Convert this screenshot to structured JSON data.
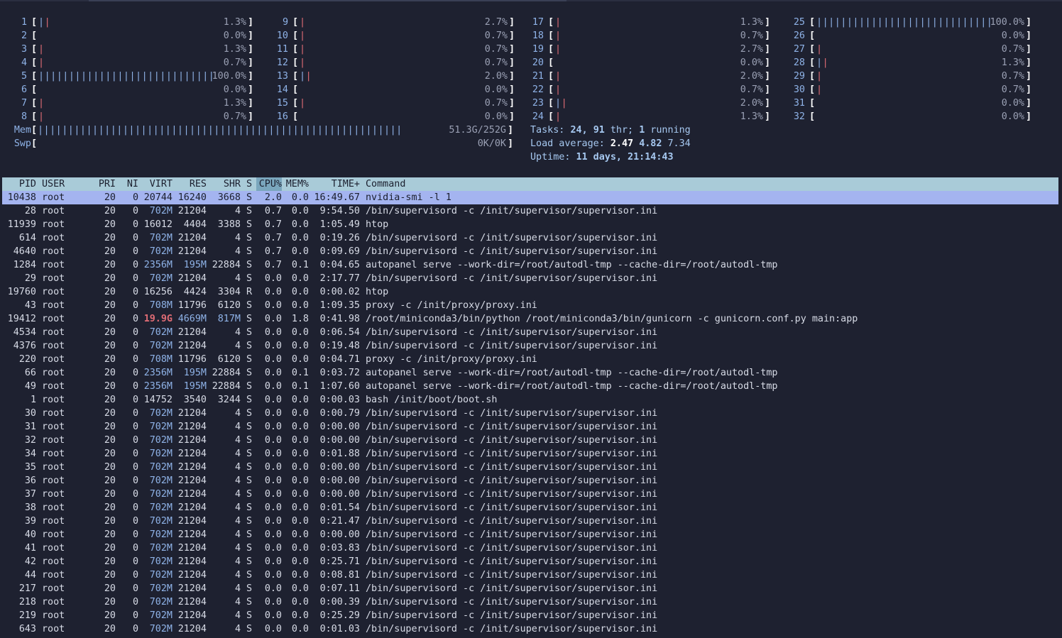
{
  "cpus": [
    {
      "n": "1",
      "bars": "||",
      "pct": "1.3%",
      "level": 0.013
    },
    {
      "n": "2",
      "bars": "",
      "pct": "0.0%",
      "level": 0.0
    },
    {
      "n": "3",
      "bars": "|",
      "pct": "1.3%",
      "level": 0.013
    },
    {
      "n": "4",
      "bars": "|",
      "pct": "0.7%",
      "level": 0.007
    },
    {
      "n": "5",
      "bars": "||||||||||||||||||||||||||||||||||||||||||",
      "pct": "100.0%",
      "level": 1.0
    },
    {
      "n": "6",
      "bars": "",
      "pct": "0.0%",
      "level": 0.0
    },
    {
      "n": "7",
      "bars": "|",
      "pct": "1.3%",
      "level": 0.013
    },
    {
      "n": "8",
      "bars": "|",
      "pct": "0.7%",
      "level": 0.007
    },
    {
      "n": "9",
      "bars": "|",
      "pct": "2.7%",
      "level": 0.027
    },
    {
      "n": "10",
      "bars": "|",
      "pct": "0.7%",
      "level": 0.007
    },
    {
      "n": "11",
      "bars": "|",
      "pct": "0.7%",
      "level": 0.007
    },
    {
      "n": "12",
      "bars": "|",
      "pct": "0.7%",
      "level": 0.007
    },
    {
      "n": "13",
      "bars": "||",
      "pct": "2.0%",
      "level": 0.02
    },
    {
      "n": "14",
      "bars": "",
      "pct": "0.0%",
      "level": 0.0
    },
    {
      "n": "15",
      "bars": "|",
      "pct": "0.7%",
      "level": 0.007
    },
    {
      "n": "16",
      "bars": "",
      "pct": "0.0%",
      "level": 0.0
    },
    {
      "n": "17",
      "bars": "|",
      "pct": "1.3%",
      "level": 0.013
    },
    {
      "n": "18",
      "bars": "|",
      "pct": "0.7%",
      "level": 0.007
    },
    {
      "n": "19",
      "bars": "|",
      "pct": "2.7%",
      "level": 0.027
    },
    {
      "n": "20",
      "bars": "",
      "pct": "0.0%",
      "level": 0.0
    },
    {
      "n": "21",
      "bars": "|",
      "pct": "2.0%",
      "level": 0.02
    },
    {
      "n": "22",
      "bars": "|",
      "pct": "0.7%",
      "level": 0.007
    },
    {
      "n": "23",
      "bars": "||",
      "pct": "2.0%",
      "level": 0.02
    },
    {
      "n": "24",
      "bars": "|",
      "pct": "1.3%",
      "level": 0.013
    },
    {
      "n": "25",
      "bars": "||||||||||||||||||||||||||||||||||||||||||",
      "pct": "100.0%",
      "level": 1.0
    },
    {
      "n": "26",
      "bars": "",
      "pct": "0.0%",
      "level": 0.0
    },
    {
      "n": "27",
      "bars": "|",
      "pct": "0.7%",
      "level": 0.007
    },
    {
      "n": "28",
      "bars": "||",
      "pct": "1.3%",
      "level": 0.013
    },
    {
      "n": "29",
      "bars": "|",
      "pct": "0.7%",
      "level": 0.007
    },
    {
      "n": "30",
      "bars": "|",
      "pct": "0.7%",
      "level": 0.007
    },
    {
      "n": "31",
      "bars": "",
      "pct": "0.0%",
      "level": 0.0
    },
    {
      "n": "32",
      "bars": "",
      "pct": "0.0%",
      "level": 0.0
    }
  ],
  "mem": {
    "label": "Mem",
    "bars": "|||||||||||||||||||||||||||||||||||||||||||||||||||||||||||||||||||||||||||||||||||",
    "value": "51.3G/252G"
  },
  "swp": {
    "label": "Swp",
    "value": "0K/0K"
  },
  "tasks": {
    "prefix": "Tasks: ",
    "count": "24",
    "sep": ", ",
    "thr": "91",
    "thr_label": " thr; ",
    "running": "1",
    "running_label": " running"
  },
  "load": {
    "prefix": "Load average: ",
    "l1": "2.47",
    "l5": "4.82",
    "l15": "7.34"
  },
  "uptime": {
    "prefix": "Uptime: ",
    "value": "11 days, 21:14:43"
  },
  "columns": {
    "pid": "PID",
    "user": "USER",
    "pri": "PRI",
    "ni": "NI",
    "virt": "VIRT",
    "res": "RES",
    "shr": "SHR",
    "s": "S",
    "cpu": "CPU%",
    "mem": "MEM%",
    "time": "TIME+",
    "cmd": "Command"
  },
  "processes": [
    {
      "pid": "10438",
      "user": "root",
      "pri": "20",
      "ni": "0",
      "virt": "20744",
      "res": "16240",
      "shr": "3668",
      "s": "S",
      "cpu": "2.0",
      "mem": "0.0",
      "time": "16:49.67",
      "cmd": "nvidia-smi -l 1"
    },
    {
      "pid": "28",
      "user": "root",
      "pri": "20",
      "ni": "0",
      "virt": "702M",
      "res": "21204",
      "shr": "4",
      "s": "S",
      "cpu": "0.7",
      "mem": "0.0",
      "time": "9:54.50",
      "cmd": "/bin/supervisord -c /init/supervisor/supervisor.ini"
    },
    {
      "pid": "11939",
      "user": "root",
      "pri": "20",
      "ni": "0",
      "virt": "16012",
      "res": "4404",
      "shr": "3388",
      "s": "S",
      "cpu": "0.7",
      "mem": "0.0",
      "time": "1:05.49",
      "cmd": "htop"
    },
    {
      "pid": "614",
      "user": "root",
      "pri": "20",
      "ni": "0",
      "virt": "702M",
      "res": "21204",
      "shr": "4",
      "s": "S",
      "cpu": "0.7",
      "mem": "0.0",
      "time": "0:19.26",
      "cmd": "/bin/supervisord -c /init/supervisor/supervisor.ini"
    },
    {
      "pid": "4640",
      "user": "root",
      "pri": "20",
      "ni": "0",
      "virt": "702M",
      "res": "21204",
      "shr": "4",
      "s": "S",
      "cpu": "0.7",
      "mem": "0.0",
      "time": "0:09.69",
      "cmd": "/bin/supervisord -c /init/supervisor/supervisor.ini"
    },
    {
      "pid": "1284",
      "user": "root",
      "pri": "20",
      "ni": "0",
      "virt": "2356M",
      "res": "195M",
      "shr": "22884",
      "s": "S",
      "cpu": "0.7",
      "mem": "0.1",
      "time": "0:04.65",
      "cmd": "autopanel serve --work-dir=/root/autodl-tmp --cache-dir=/root/autodl-tmp"
    },
    {
      "pid": "29",
      "user": "root",
      "pri": "20",
      "ni": "0",
      "virt": "702M",
      "res": "21204",
      "shr": "4",
      "s": "S",
      "cpu": "0.0",
      "mem": "0.0",
      "time": "2:17.77",
      "cmd": "/bin/supervisord -c /init/supervisor/supervisor.ini"
    },
    {
      "pid": "19760",
      "user": "root",
      "pri": "20",
      "ni": "0",
      "virt": "16256",
      "res": "4424",
      "shr": "3304",
      "s": "R",
      "cpu": "0.0",
      "mem": "0.0",
      "time": "0:00.02",
      "cmd": "htop"
    },
    {
      "pid": "43",
      "user": "root",
      "pri": "20",
      "ni": "0",
      "virt": "708M",
      "res": "11796",
      "shr": "6120",
      "s": "S",
      "cpu": "0.0",
      "mem": "0.0",
      "time": "1:09.35",
      "cmd": "proxy -c /init/proxy/proxy.ini"
    },
    {
      "pid": "19412",
      "user": "root",
      "pri": "20",
      "ni": "0",
      "virt": "19.9G",
      "res": "4669M",
      "shr": "817M",
      "s": "S",
      "cpu": "0.0",
      "mem": "1.8",
      "time": "0:41.98",
      "cmd": "/root/miniconda3/bin/python /root/miniconda3/bin/gunicorn -c gunicorn.conf.py main:app"
    },
    {
      "pid": "4534",
      "user": "root",
      "pri": "20",
      "ni": "0",
      "virt": "702M",
      "res": "21204",
      "shr": "4",
      "s": "S",
      "cpu": "0.0",
      "mem": "0.0",
      "time": "0:06.54",
      "cmd": "/bin/supervisord -c /init/supervisor/supervisor.ini"
    },
    {
      "pid": "4376",
      "user": "root",
      "pri": "20",
      "ni": "0",
      "virt": "702M",
      "res": "21204",
      "shr": "4",
      "s": "S",
      "cpu": "0.0",
      "mem": "0.0",
      "time": "0:19.48",
      "cmd": "/bin/supervisord -c /init/supervisor/supervisor.ini"
    },
    {
      "pid": "220",
      "user": "root",
      "pri": "20",
      "ni": "0",
      "virt": "708M",
      "res": "11796",
      "shr": "6120",
      "s": "S",
      "cpu": "0.0",
      "mem": "0.0",
      "time": "0:04.71",
      "cmd": "proxy -c /init/proxy/proxy.ini"
    },
    {
      "pid": "66",
      "user": "root",
      "pri": "20",
      "ni": "0",
      "virt": "2356M",
      "res": "195M",
      "shr": "22884",
      "s": "S",
      "cpu": "0.0",
      "mem": "0.1",
      "time": "0:03.72",
      "cmd": "autopanel serve --work-dir=/root/autodl-tmp --cache-dir=/root/autodl-tmp"
    },
    {
      "pid": "49",
      "user": "root",
      "pri": "20",
      "ni": "0",
      "virt": "2356M",
      "res": "195M",
      "shr": "22884",
      "s": "S",
      "cpu": "0.0",
      "mem": "0.1",
      "time": "1:07.60",
      "cmd": "autopanel serve --work-dir=/root/autodl-tmp --cache-dir=/root/autodl-tmp"
    },
    {
      "pid": "1",
      "user": "root",
      "pri": "20",
      "ni": "0",
      "virt": "14752",
      "res": "3540",
      "shr": "3244",
      "s": "S",
      "cpu": "0.0",
      "mem": "0.0",
      "time": "0:00.03",
      "cmd": "bash /init/boot/boot.sh"
    },
    {
      "pid": "30",
      "user": "root",
      "pri": "20",
      "ni": "0",
      "virt": "702M",
      "res": "21204",
      "shr": "4",
      "s": "S",
      "cpu": "0.0",
      "mem": "0.0",
      "time": "0:00.79",
      "cmd": "/bin/supervisord -c /init/supervisor/supervisor.ini"
    },
    {
      "pid": "31",
      "user": "root",
      "pri": "20",
      "ni": "0",
      "virt": "702M",
      "res": "21204",
      "shr": "4",
      "s": "S",
      "cpu": "0.0",
      "mem": "0.0",
      "time": "0:00.00",
      "cmd": "/bin/supervisord -c /init/supervisor/supervisor.ini"
    },
    {
      "pid": "32",
      "user": "root",
      "pri": "20",
      "ni": "0",
      "virt": "702M",
      "res": "21204",
      "shr": "4",
      "s": "S",
      "cpu": "0.0",
      "mem": "0.0",
      "time": "0:00.00",
      "cmd": "/bin/supervisord -c /init/supervisor/supervisor.ini"
    },
    {
      "pid": "34",
      "user": "root",
      "pri": "20",
      "ni": "0",
      "virt": "702M",
      "res": "21204",
      "shr": "4",
      "s": "S",
      "cpu": "0.0",
      "mem": "0.0",
      "time": "0:01.88",
      "cmd": "/bin/supervisord -c /init/supervisor/supervisor.ini"
    },
    {
      "pid": "35",
      "user": "root",
      "pri": "20",
      "ni": "0",
      "virt": "702M",
      "res": "21204",
      "shr": "4",
      "s": "S",
      "cpu": "0.0",
      "mem": "0.0",
      "time": "0:00.00",
      "cmd": "/bin/supervisord -c /init/supervisor/supervisor.ini"
    },
    {
      "pid": "36",
      "user": "root",
      "pri": "20",
      "ni": "0",
      "virt": "702M",
      "res": "21204",
      "shr": "4",
      "s": "S",
      "cpu": "0.0",
      "mem": "0.0",
      "time": "0:00.00",
      "cmd": "/bin/supervisord -c /init/supervisor/supervisor.ini"
    },
    {
      "pid": "37",
      "user": "root",
      "pri": "20",
      "ni": "0",
      "virt": "702M",
      "res": "21204",
      "shr": "4",
      "s": "S",
      "cpu": "0.0",
      "mem": "0.0",
      "time": "0:00.00",
      "cmd": "/bin/supervisord -c /init/supervisor/supervisor.ini"
    },
    {
      "pid": "38",
      "user": "root",
      "pri": "20",
      "ni": "0",
      "virt": "702M",
      "res": "21204",
      "shr": "4",
      "s": "S",
      "cpu": "0.0",
      "mem": "0.0",
      "time": "0:01.54",
      "cmd": "/bin/supervisord -c /init/supervisor/supervisor.ini"
    },
    {
      "pid": "39",
      "user": "root",
      "pri": "20",
      "ni": "0",
      "virt": "702M",
      "res": "21204",
      "shr": "4",
      "s": "S",
      "cpu": "0.0",
      "mem": "0.0",
      "time": "0:21.47",
      "cmd": "/bin/supervisord -c /init/supervisor/supervisor.ini"
    },
    {
      "pid": "40",
      "user": "root",
      "pri": "20",
      "ni": "0",
      "virt": "702M",
      "res": "21204",
      "shr": "4",
      "s": "S",
      "cpu": "0.0",
      "mem": "0.0",
      "time": "0:00.00",
      "cmd": "/bin/supervisord -c /init/supervisor/supervisor.ini"
    },
    {
      "pid": "41",
      "user": "root",
      "pri": "20",
      "ni": "0",
      "virt": "702M",
      "res": "21204",
      "shr": "4",
      "s": "S",
      "cpu": "0.0",
      "mem": "0.0",
      "time": "0:03.83",
      "cmd": "/bin/supervisord -c /init/supervisor/supervisor.ini"
    },
    {
      "pid": "42",
      "user": "root",
      "pri": "20",
      "ni": "0",
      "virt": "702M",
      "res": "21204",
      "shr": "4",
      "s": "S",
      "cpu": "0.0",
      "mem": "0.0",
      "time": "0:25.71",
      "cmd": "/bin/supervisord -c /init/supervisor/supervisor.ini"
    },
    {
      "pid": "44",
      "user": "root",
      "pri": "20",
      "ni": "0",
      "virt": "702M",
      "res": "21204",
      "shr": "4",
      "s": "S",
      "cpu": "0.0",
      "mem": "0.0",
      "time": "0:08.81",
      "cmd": "/bin/supervisord -c /init/supervisor/supervisor.ini"
    },
    {
      "pid": "217",
      "user": "root",
      "pri": "20",
      "ni": "0",
      "virt": "702M",
      "res": "21204",
      "shr": "4",
      "s": "S",
      "cpu": "0.0",
      "mem": "0.0",
      "time": "0:07.11",
      "cmd": "/bin/supervisord -c /init/supervisor/supervisor.ini"
    },
    {
      "pid": "218",
      "user": "root",
      "pri": "20",
      "ni": "0",
      "virt": "702M",
      "res": "21204",
      "shr": "4",
      "s": "S",
      "cpu": "0.0",
      "mem": "0.0",
      "time": "0:00.39",
      "cmd": "/bin/supervisord -c /init/supervisor/supervisor.ini"
    },
    {
      "pid": "219",
      "user": "root",
      "pri": "20",
      "ni": "0",
      "virt": "702M",
      "res": "21204",
      "shr": "4",
      "s": "S",
      "cpu": "0.0",
      "mem": "0.0",
      "time": "0:25.29",
      "cmd": "/bin/supervisord -c /init/supervisor/supervisor.ini"
    },
    {
      "pid": "643",
      "user": "root",
      "pri": "20",
      "ni": "0",
      "virt": "702M",
      "res": "21204",
      "shr": "4",
      "s": "S",
      "cpu": "0.0",
      "mem": "0.0",
      "time": "0:01.03",
      "cmd": "/bin/supervisord -c /init/supervisor/supervisor.ini"
    }
  ],
  "colors": {
    "background": "#1e2130",
    "header_bg": "#a9cbd8",
    "selected_bg": "#a4b4f0",
    "bar": "#8fb3e8",
    "bar_red": "#e06c75"
  }
}
